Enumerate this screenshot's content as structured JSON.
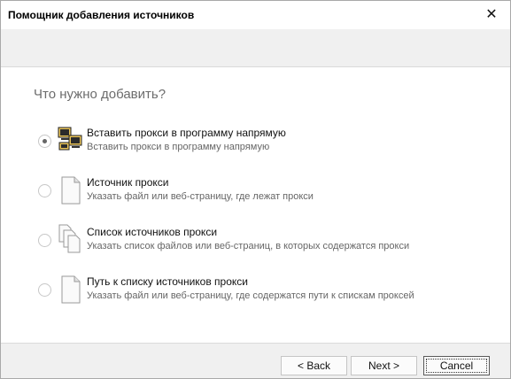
{
  "window": {
    "title": "Помощник добавления источников",
    "close_glyph": "✕"
  },
  "question": "Что нужно добавить?",
  "options": [
    {
      "title": "Вставить прокси в программу напрямую",
      "description": "Вставить прокси в программу напрямую",
      "selected": true,
      "icon": "network-computers-icon"
    },
    {
      "title": "Источник прокси",
      "description": "Указать файл или веб-страницу, где лежат прокси",
      "selected": false,
      "icon": "document-icon"
    },
    {
      "title": "Список источников прокси",
      "description": "Указать список файлов или веб-страниц, в которых содержатся прокси",
      "selected": false,
      "icon": "documents-icon"
    },
    {
      "title": "Путь к списку источников прокси",
      "description": "Указать файл или веб-страницу, где содержатся пути к спискам проксей",
      "selected": false,
      "icon": "document-icon"
    }
  ],
  "buttons": {
    "back": "< Back",
    "next": "Next >",
    "cancel": "Cancel"
  }
}
